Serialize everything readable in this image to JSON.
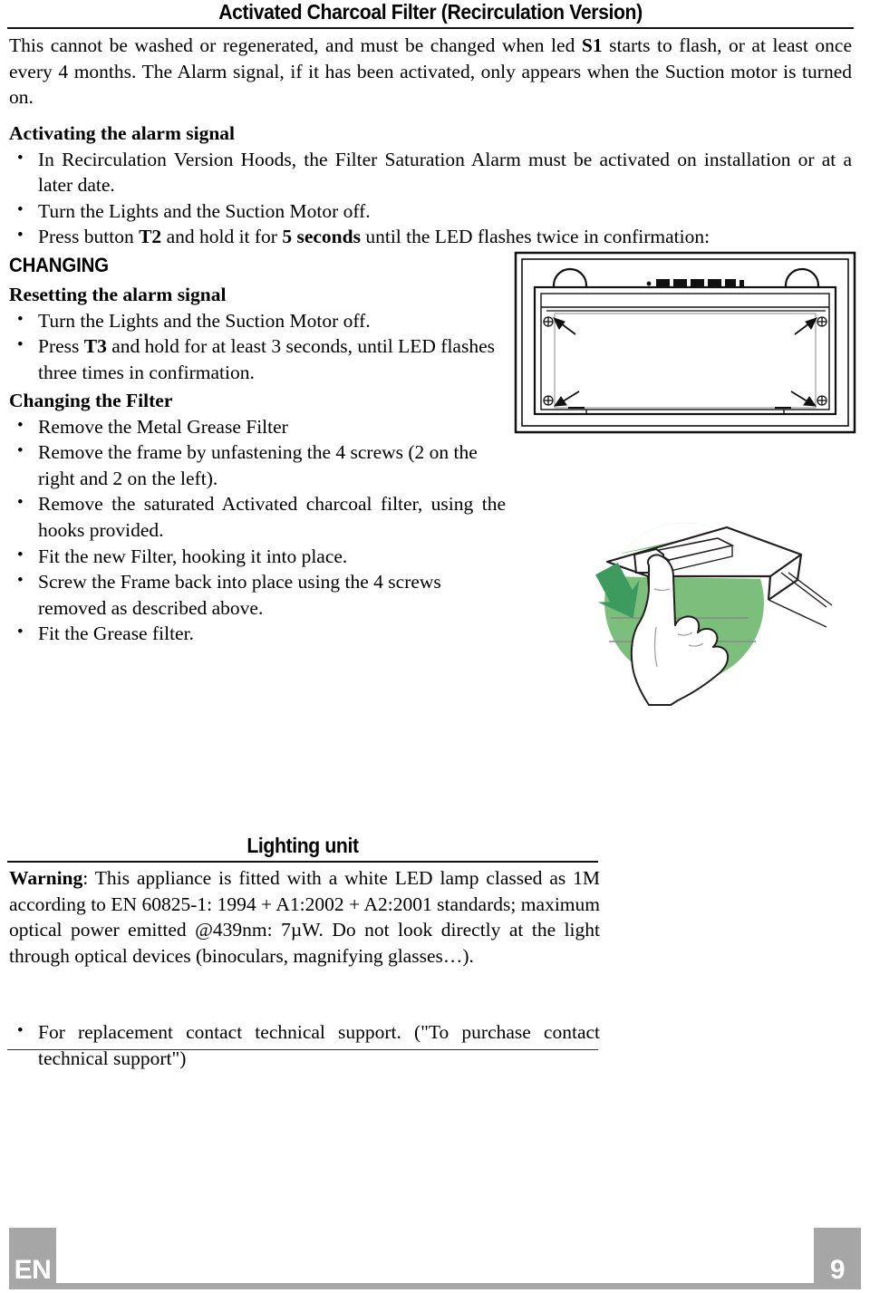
{
  "page": {
    "language_code": "EN",
    "page_number": "9"
  },
  "sections": [
    {
      "id": "activated-charcoal-filter",
      "title": "Activated Charcoal Filter (Recirculation Version)",
      "intro": "This cannot be washed or regenerated, and must be changed when led S1 starts to flash, or at least once every 4 months. The Alarm signal, if it has been activated, only appears when the Suction motor is turned on.",
      "intro_parts": {
        "a": "This cannot be washed or regenerated, and must be changed when led ",
        "bold1": "S1",
        "b": " starts to flash, or at least once every 4 months. The Alarm signal, if it has been activated, only appears when the Suction motor is turned on."
      },
      "subsections": [
        {
          "heading": "Activating the alarm signal",
          "items": [
            "In Recirculation Version Hoods, the Filter Saturation Alarm must be activated on installation or at a later date.",
            "Turn the Lights and the Suction Motor off.",
            "Press button T2 and hold it for 5 seconds until the LED flashes twice in confirmation:"
          ],
          "item_parts": [
            {
              "a": "Press button ",
              "bold1": "T2",
              "b": " and hold it for ",
              "bold2": "5 seconds",
              "c": " until the LED flashes twice in confirmation:"
            }
          ]
        },
        {
          "heading": "CHANGING",
          "style": "caps-sans"
        },
        {
          "heading": "Resetting the alarm signal",
          "items": [
            "Turn the Lights and the Suction Motor off.",
            "Press T3 and hold for at least 3 seconds, until LED flashes three times in confirmation."
          ],
          "item_parts": [
            {
              "a": "Press ",
              "bold1": "T3",
              "b": " and hold for at least 3 seconds, until LED flashes three times in confirmation."
            }
          ]
        },
        {
          "heading": "Changing the Filter",
          "items": [
            "Remove the Metal Grease Filter",
            "Remove the frame by unfastening the 4 screws (2 on the right and 2 on the left).",
            "Remove the saturated Activated charcoal filter, using the hooks provided.",
            "Fit the new Filter, hooking it into place.",
            "Screw the Frame back into place using the 4 screws removed as described above.",
            "Fit the Grease filter."
          ]
        }
      ]
    },
    {
      "id": "lighting-unit",
      "title": "Lighting unit",
      "warning_parts": {
        "bold1": "Warning",
        "a": ": This appliance is fitted with a white LED lamp classed as 1M according to EN 60825-1: 1994 + A1:2002 + A2:2001 standards; maximum optical power emitted @439nm: 7µW. Do not look directly at the light through optical devices (binoculars, magnifying glasses…)."
      },
      "items": [
        "For replacement contact technical support. (\"To purchase contact technical support\")"
      ]
    }
  ],
  "illustrations": {
    "hood_front": {
      "name": "hood-front-screw-diagram",
      "description": "Front view of cooker hood showing two round lamps, a control panel strip and four frame screws marked with arrows",
      "screw_count": 4,
      "lamp_count": 2,
      "control_buttons": 5
    },
    "hand_filter": {
      "name": "hand-releasing-filter-illustration",
      "description": "Hand pressing the charcoal filter hook to release it",
      "highlight_color": "#7cbf7c",
      "arrow_color": "#3f9b62"
    }
  },
  "colors": {
    "footer_grey": "#a6a6a6",
    "text": "#000000",
    "rule": "#111111",
    "illustration_green": "#7cbf7c",
    "illustration_arrow_green": "#3d9b5f"
  }
}
